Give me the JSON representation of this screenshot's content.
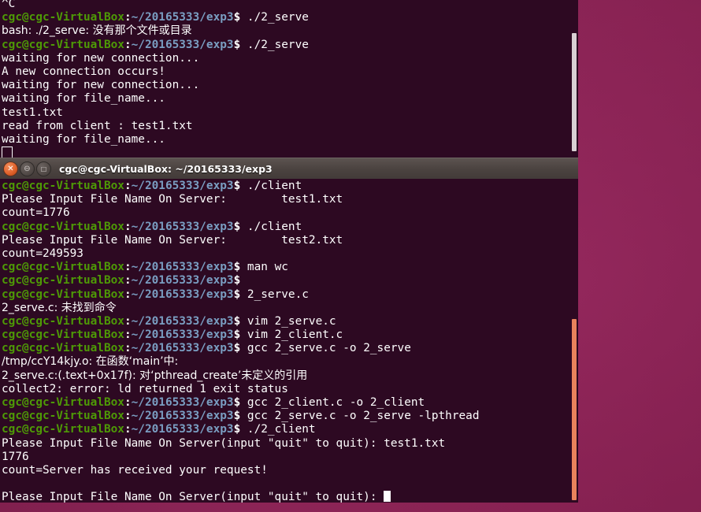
{
  "desktop": {
    "wallpaper_color": "#8d2557"
  },
  "top_terminal": {
    "name": "server-terminal",
    "scrollbar": {
      "state": "idle",
      "color": "#d9d0d4"
    },
    "prompt": {
      "user_host": "cgc@cgc-VirtualBox",
      "separator": ":",
      "path": "~/20165333/exp3",
      "sigil": "$"
    },
    "lines": [
      {
        "type": "output",
        "text": "^C"
      },
      {
        "type": "prompt",
        "command": " ./2_serve"
      },
      {
        "type": "output",
        "text": "bash: ./2_serve: 没有那个文件或目录"
      },
      {
        "type": "prompt",
        "command": " ./2_serve"
      },
      {
        "type": "output",
        "text": "waiting for new connection..."
      },
      {
        "type": "output",
        "text": "A new connection occurs!"
      },
      {
        "type": "output",
        "text": "waiting for new connection..."
      },
      {
        "type": "output",
        "text": "waiting for file_name..."
      },
      {
        "type": "output",
        "text": "test1.txt"
      },
      {
        "type": "output",
        "text": "read from client : test1.txt"
      },
      {
        "type": "output",
        "text": "waiting for file_name..."
      },
      {
        "type": "cursor_hollow",
        "text": ""
      }
    ]
  },
  "bottom_window": {
    "name": "client-terminal-window",
    "titlebar": {
      "title": "cgc@cgc-VirtualBox: ~/20165333/exp3",
      "buttons": [
        {
          "name": "close-button",
          "glyph": "✕",
          "label": "Close"
        },
        {
          "name": "minimize-button",
          "glyph": "⊖",
          "label": "Minimize"
        },
        {
          "name": "maximize-button",
          "glyph": "□",
          "label": "Maximize"
        }
      ]
    },
    "scrollbar": {
      "state": "active",
      "color": "#e9825c"
    },
    "prompt": {
      "user_host": "cgc@cgc-VirtualBox",
      "separator": ":",
      "path": "~/20165333/exp3",
      "sigil": "$"
    },
    "lines": [
      {
        "type": "prompt",
        "command": " ./client"
      },
      {
        "type": "output",
        "text": "Please Input File Name On Server:        test1.txt"
      },
      {
        "type": "output",
        "text": "count=1776"
      },
      {
        "type": "prompt",
        "command": " ./client"
      },
      {
        "type": "output",
        "text": "Please Input File Name On Server:        test2.txt"
      },
      {
        "type": "output",
        "text": "count=249593"
      },
      {
        "type": "prompt",
        "command": " man wc"
      },
      {
        "type": "prompt",
        "command": ""
      },
      {
        "type": "prompt",
        "command": " 2_serve.c"
      },
      {
        "type": "output",
        "text": "2_serve.c: 未找到命令"
      },
      {
        "type": "prompt",
        "command": " vim 2_serve.c"
      },
      {
        "type": "prompt",
        "command": " vim 2_client.c"
      },
      {
        "type": "prompt",
        "command": " gcc 2_serve.c -o 2_serve"
      },
      {
        "type": "output",
        "text": "/tmp/ccY14kjy.o: 在函数‘main’中:"
      },
      {
        "type": "output",
        "text": "2_serve.c:(.text+0x17f): 对‘pthread_create’未定义的引用"
      },
      {
        "type": "output",
        "text": "collect2: error: ld returned 1 exit status"
      },
      {
        "type": "prompt",
        "command": " gcc 2_client.c -o 2_client"
      },
      {
        "type": "prompt",
        "command": " gcc 2_serve.c -o 2_serve -lpthread"
      },
      {
        "type": "prompt",
        "command": " ./2_client"
      },
      {
        "type": "output",
        "text": "Please Input File Name On Server(input \"quit\" to quit): test1.txt"
      },
      {
        "type": "output",
        "text": "1776"
      },
      {
        "type": "output",
        "text": "count=Server has received your request!"
      },
      {
        "type": "output",
        "text": ""
      },
      {
        "type": "cursor_line",
        "text": "Please Input File Name On Server(input \"quit\" to quit): "
      }
    ]
  }
}
